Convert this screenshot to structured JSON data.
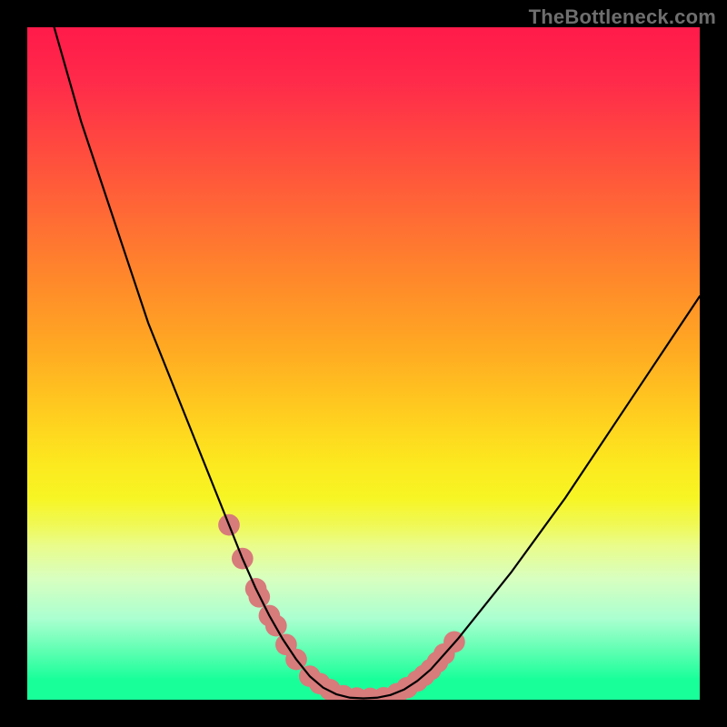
{
  "watermark": "TheBottleneck.com",
  "chart_data": {
    "type": "line",
    "title": "",
    "xlabel": "",
    "ylabel": "",
    "xlim": [
      0,
      100
    ],
    "ylim": [
      0,
      100
    ],
    "grid": false,
    "series": [
      {
        "name": "bottleneck-curve",
        "color": "#000000",
        "x": [
          4,
          6,
          8,
          10,
          12,
          14,
          16,
          18,
          20,
          22,
          24,
          26,
          28,
          30,
          32,
          34,
          36,
          38,
          40,
          42,
          44,
          46,
          48,
          50,
          52,
          54,
          56,
          58,
          60,
          64,
          68,
          72,
          76,
          80,
          84,
          88,
          92,
          96,
          100
        ],
        "values": [
          100,
          93,
          86,
          80,
          74,
          68,
          62,
          56,
          51,
          46,
          41,
          36,
          31,
          26,
          21,
          16.5,
          12.5,
          9,
          6,
          3.5,
          1.8,
          0.8,
          0.3,
          0.2,
          0.3,
          0.7,
          1.5,
          2.8,
          4.5,
          9,
          14,
          19,
          24.5,
          30,
          36,
          42,
          48,
          54,
          60
        ]
      }
    ],
    "highlight_points": {
      "name": "marker-dots",
      "color": "#d77b7b",
      "radius_pct": 1.6,
      "x": [
        30,
        32,
        34,
        34.5,
        36,
        37,
        38.5,
        40,
        42,
        43.5,
        45,
        47,
        49,
        51,
        53,
        55,
        56.5,
        58,
        59,
        60,
        61,
        62,
        63.5
      ],
      "values": [
        26,
        21,
        16.5,
        15.3,
        12.5,
        11,
        8.2,
        6,
        3.5,
        2.4,
        1.5,
        0.6,
        0.25,
        0.2,
        0.3,
        0.9,
        1.8,
        2.8,
        3.6,
        4.5,
        5.6,
        6.8,
        8.6
      ]
    }
  }
}
